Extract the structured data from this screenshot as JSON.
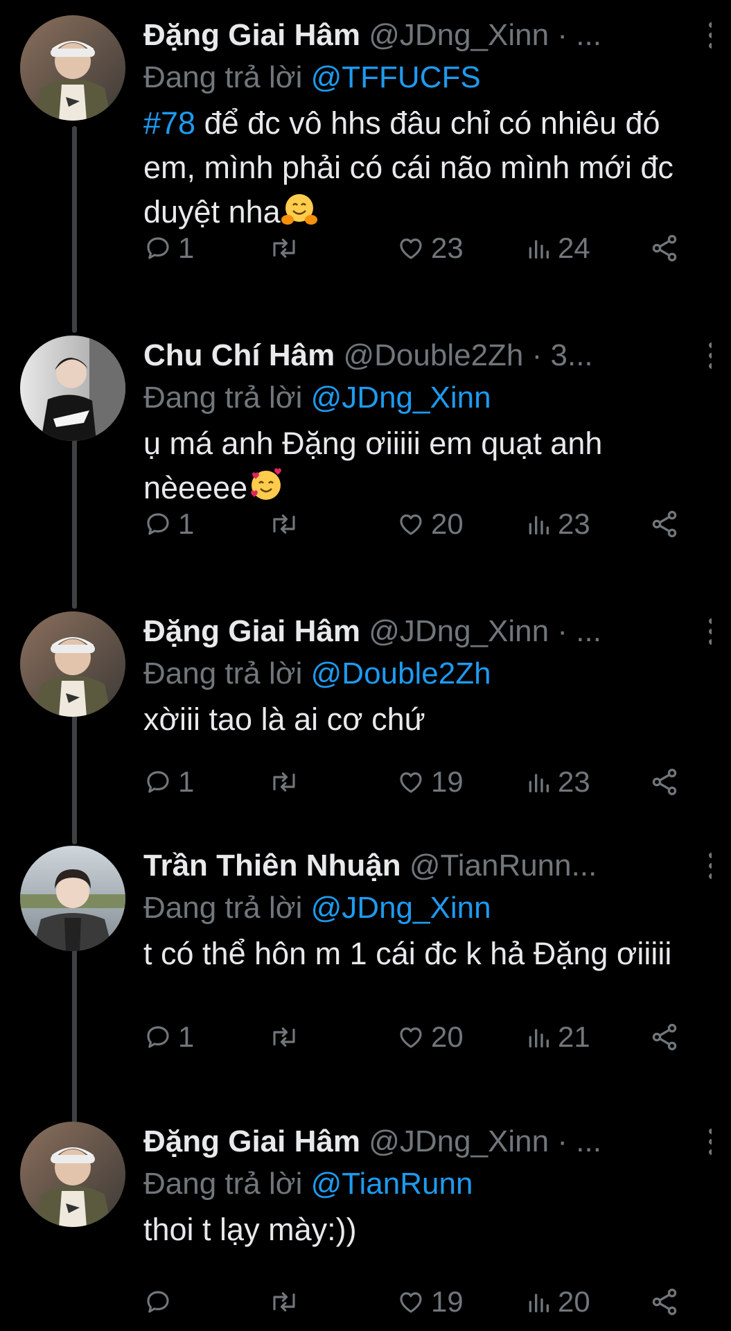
{
  "colors": {
    "background": "#000000",
    "text": "#e7e9ea",
    "muted": "#71767b",
    "link": "#1d9bf0",
    "thread_line": "#3e4144"
  },
  "tweets": [
    {
      "name": "Đặng Giai Hâm",
      "handle": "@JDng_Xinn",
      "dot": "·",
      "time": "...",
      "reply_prefix": "Đang trả lời",
      "reply_to": "@TFFUCFS",
      "hashtag": "#78",
      "text": " để đc vô hhs đâu chỉ có nhiêu đó em, mình phải có cái não mình mới đc duyệt nha",
      "emoji": "hugging-face-icon",
      "replies": "1",
      "retweets": "",
      "likes": "23",
      "views": "24"
    },
    {
      "name": "Chu Chí Hâm",
      "handle": "@Double2Zh",
      "dot": "·",
      "time": "3...",
      "reply_prefix": "Đang trả lời",
      "reply_to": "@JDng_Xinn",
      "hashtag": "",
      "text": "ụ má anh Đặng ơiiiii em quạt anh nèeeee",
      "emoji": "smiling-face-with-hearts-icon",
      "replies": "1",
      "retweets": "",
      "likes": "20",
      "views": "23"
    },
    {
      "name": "Đặng Giai Hâm",
      "handle": "@JDng_Xinn",
      "dot": "·",
      "time": "...",
      "reply_prefix": "Đang trả lời",
      "reply_to": "@Double2Zh",
      "hashtag": "",
      "text": "xờiii tao là ai cơ chứ",
      "emoji": "",
      "replies": "1",
      "retweets": "",
      "likes": "19",
      "views": "23"
    },
    {
      "name": "Trần Thiên Nhuận",
      "handle": "@TianRunn...",
      "dot": "",
      "time": "",
      "reply_prefix": "Đang trả lời",
      "reply_to": "@JDng_Xinn",
      "hashtag": "",
      "text": "t có thể hôn m 1 cái đc k hả Đặng ơiiiii",
      "emoji": "",
      "replies": "1",
      "retweets": "",
      "likes": "20",
      "views": "21"
    },
    {
      "name": "Đặng Giai Hâm",
      "handle": "@JDng_Xinn",
      "dot": "·",
      "time": "...",
      "reply_prefix": "Đang trả lời",
      "reply_to": "@TianRunn",
      "hashtag": "",
      "text": "thoi t lạy mày:))",
      "emoji": "",
      "replies": "",
      "retweets": "",
      "likes": "19",
      "views": "20"
    }
  ]
}
